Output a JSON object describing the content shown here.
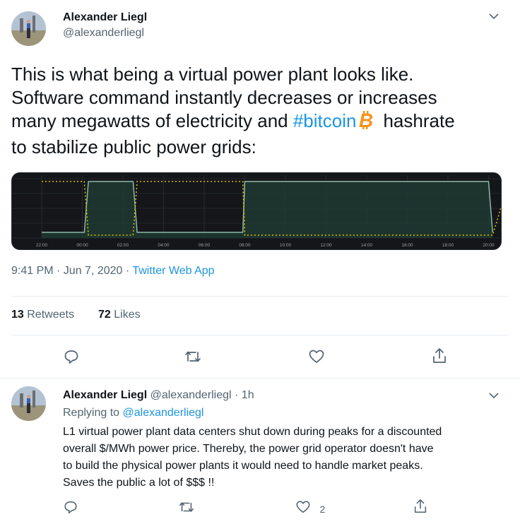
{
  "tweet": {
    "author_name": "Alexander Liegl",
    "author_handle": "@alexanderliegl",
    "text_lines": [
      "This is what being a virtual power plant looks like.",
      "Software command instantly decreases or increases",
      "many megawatts of electricity and ",
      "hashrate",
      "to stabilize public power grids:"
    ],
    "hashtag": "#bitcoin",
    "timestamp": "9:41 PM · Jun 7, 2020 · ",
    "source": "Twitter Web App",
    "retweets_count": "13",
    "retweets_label": "Retweets",
    "likes_count": "72",
    "likes_label": "Likes"
  },
  "reply": {
    "author_name": "Alexander Liegl",
    "author_handle_time": "@alexanderliegl · 1h",
    "replying_prefix": "Replying to ",
    "replying_to": "@alexanderliegl",
    "text_lines": [
      "L1 virtual power plant data centers shut down during peaks for a discounted",
      "overall $/MWh power price. Thereby, the power grid operator doesn't have",
      "to build the physical power plants it would need to handle market peaks.",
      "Saves the public a lot of $$$ !!"
    ],
    "like_count": "2"
  },
  "icons": {
    "reply": "reply-icon",
    "retweet": "retweet-icon",
    "like": "heart-icon",
    "share": "share-icon",
    "bitcoin": "bitcoin-icon",
    "more": "chevron-down-icon"
  },
  "colors": {
    "link": "#1b95e0",
    "bitcoin": "#f7931a",
    "chart_line": "#8fb8a8",
    "chart_fill": "#1f3a33",
    "chart_threshold": "#e0c000"
  },
  "chart_data": {
    "type": "area",
    "x_ticks": [
      "22:00",
      "00:00",
      "02:00",
      "04:00",
      "06:00",
      "08:00",
      "10:00",
      "12:00",
      "14:00",
      "16:00",
      "18:00",
      "20:00"
    ],
    "series": [
      {
        "x": [
          22.0,
          24.1,
          24.3,
          26.5,
          26.7,
          29.0,
          31.9,
          32.0,
          44.0,
          44.2
        ],
        "values": [
          0.1,
          0.1,
          1.0,
          1.0,
          0.1,
          0.1,
          0.1,
          1.0,
          1.0,
          0.1
        ]
      }
    ],
    "threshold": {
      "x": [
        22.0,
        24.1,
        24.3,
        26.5,
        26.7,
        31.9,
        32.0,
        44.2,
        45.0
      ],
      "values": [
        1.0,
        1.0,
        0.05,
        0.05,
        1.0,
        1.0,
        0.05,
        0.05,
        1.0
      ]
    }
  }
}
